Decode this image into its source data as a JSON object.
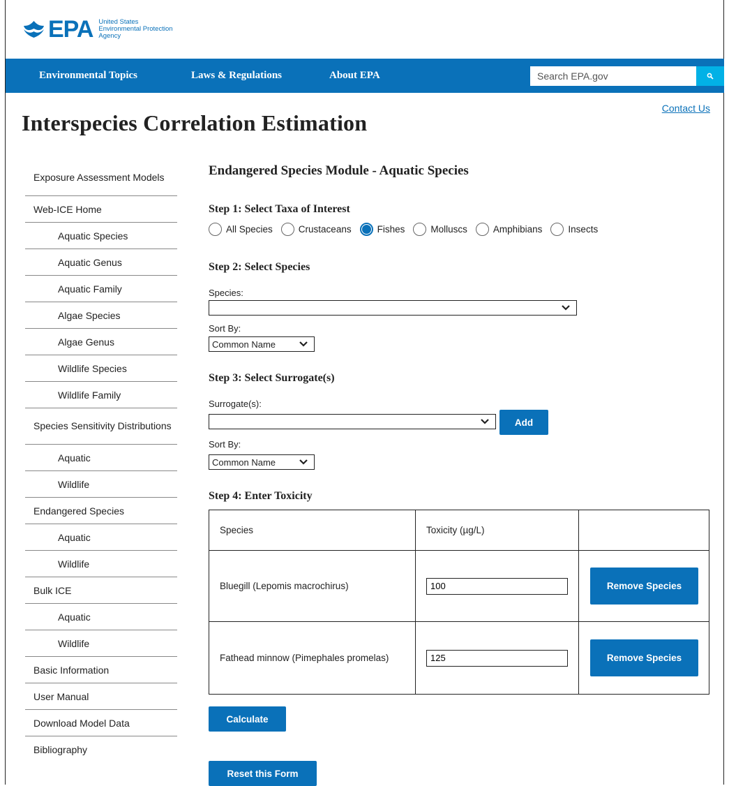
{
  "logo": {
    "text": "EPA",
    "line1": "United States",
    "line2": "Environmental Protection",
    "line3": "Agency"
  },
  "nav": {
    "items": [
      "Environmental Topics",
      "Laws & Regulations",
      "About EPA"
    ],
    "search_placeholder": "Search EPA.gov"
  },
  "page_title": "Interspecies Correlation Estimation",
  "contact_label": "Contact Us",
  "sidebar": [
    {
      "label": "Exposure Assessment Models",
      "level": "top"
    },
    {
      "label": "Web-ICE Home",
      "level": "top"
    },
    {
      "label": "Aquatic Species",
      "level": "sub"
    },
    {
      "label": "Aquatic Genus",
      "level": "sub"
    },
    {
      "label": "Aquatic Family",
      "level": "sub"
    },
    {
      "label": "Algae Species",
      "level": "sub"
    },
    {
      "label": "Algae Genus",
      "level": "sub"
    },
    {
      "label": "Wildlife Species",
      "level": "sub"
    },
    {
      "label": "Wildlife Family",
      "level": "sub"
    },
    {
      "label": "Species Sensitivity Distributions",
      "level": "top"
    },
    {
      "label": "Aquatic",
      "level": "sub"
    },
    {
      "label": "Wildlife",
      "level": "sub"
    },
    {
      "label": "Endangered Species",
      "level": "top"
    },
    {
      "label": "Aquatic",
      "level": "sub"
    },
    {
      "label": "Wildlife",
      "level": "sub"
    },
    {
      "label": "Bulk ICE",
      "level": "top"
    },
    {
      "label": "Aquatic",
      "level": "sub"
    },
    {
      "label": "Wildlife",
      "level": "sub"
    },
    {
      "label": "Basic Information",
      "level": "top"
    },
    {
      "label": "User Manual",
      "level": "top"
    },
    {
      "label": "Download Model Data",
      "level": "top"
    },
    {
      "label": "Bibliography",
      "level": "top"
    }
  ],
  "main": {
    "heading": "Endangered Species Module - Aquatic Species",
    "step1": "Step 1: Select Taxa of Interest",
    "taxa": [
      {
        "label": "All Species",
        "checked": false
      },
      {
        "label": "Crustaceans",
        "checked": false
      },
      {
        "label": "Fishes",
        "checked": true
      },
      {
        "label": "Molluscs",
        "checked": false
      },
      {
        "label": "Amphibians",
        "checked": false
      },
      {
        "label": "Insects",
        "checked": false
      }
    ],
    "step2": "Step 2: Select Species",
    "species_label": "Species:",
    "species_value": "",
    "sort_by_label": "Sort By:",
    "sort_value": "Common Name",
    "step3": "Step 3: Select Surrogate(s)",
    "surrogate_label": "Surrogate(s):",
    "surrogate_value": "",
    "add_label": "Add",
    "sort_by_label2": "Sort By:",
    "sort_value2": "Common Name",
    "step4": "Step 4: Enter Toxicity",
    "table": {
      "headers": [
        "Species",
        "Toxicity (µg/L)",
        ""
      ],
      "rows": [
        {
          "species": "Bluegill (Lepomis macrochirus)",
          "toxicity": "100",
          "button": "Remove Species"
        },
        {
          "species": "Fathead minnow (Pimephales promelas)",
          "toxicity": "125",
          "button": "Remove Species"
        }
      ]
    },
    "calculate_label": "Calculate",
    "reset_label": "Reset this Form"
  },
  "colors": {
    "brand": "#0a71b9",
    "search_button": "#02b1e6"
  }
}
